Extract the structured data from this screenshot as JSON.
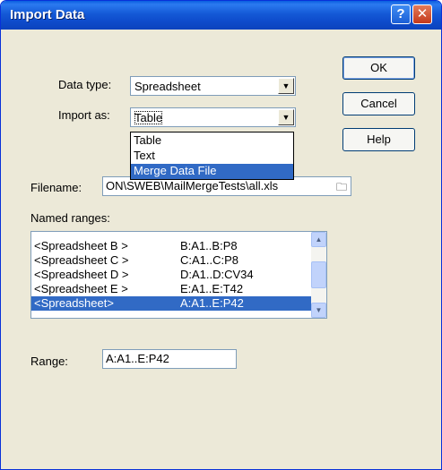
{
  "window": {
    "title": "Import Data",
    "help_glyph": "?",
    "close_glyph": "✕"
  },
  "form": {
    "data_type_label": "Data type:",
    "data_type_value": "Spreadsheet",
    "import_as_label": "Import as:",
    "import_as_value": "Table",
    "import_as_options": [
      "Table",
      "Text",
      "Merge Data File"
    ],
    "import_as_highlighted": "Merge Data File",
    "filename_label": "Filename:",
    "filename_value": "ON\\SWEB\\MailMergeTests\\all.xls",
    "named_ranges_label": "Named ranges:",
    "range_label": "Range:",
    "range_value": "A:A1..E:P42"
  },
  "named_ranges": [
    {
      "name": "<Spreadsheet B >",
      "range": "B:A1..B:P8"
    },
    {
      "name": "<Spreadsheet C >",
      "range": "C:A1..C:P8"
    },
    {
      "name": "<Spreadsheet D >",
      "range": "D:A1..D:CV34"
    },
    {
      "name": "<Spreadsheet E >",
      "range": "E:A1..E:T42"
    },
    {
      "name": "<Spreadsheet>",
      "range": "A:A1..E:P42"
    }
  ],
  "selected_range_index": 4,
  "buttons": {
    "ok": "OK",
    "cancel": "Cancel",
    "help": "Help"
  },
  "icons": {
    "dropdown_arrow": "chevron-down-icon",
    "browse": "folder-icon",
    "scroll_up": "scroll-up-icon",
    "scroll_down": "scroll-down-icon"
  },
  "colors": {
    "titlebar": "#0b4fd0",
    "selection": "#316ac5",
    "dialog_bg": "#ece9d8"
  }
}
